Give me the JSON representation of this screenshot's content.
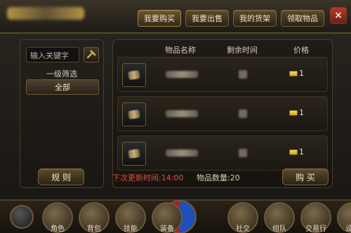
{
  "tabs": [
    "我要购买",
    "我要出售",
    "我的货架",
    "领取物品"
  ],
  "close_label": "×",
  "left_panel": {
    "search_placeholder": "输入关键字",
    "filter_title": "一级筛选",
    "filter_all": "全部"
  },
  "table": {
    "headers": [
      "物品名称",
      "剩余时间",
      "价格"
    ],
    "rows": [
      {
        "price": "1"
      },
      {
        "price": "1"
      },
      {
        "price": "1"
      }
    ]
  },
  "footer": {
    "next_refresh": "下次更新时间:14:00",
    "item_count": "物品数量:20"
  },
  "buttons": {
    "rules": "规 则",
    "buy": "购 买"
  },
  "bottom_menu": [
    "角色",
    "背包",
    "技能",
    "装备",
    "社交",
    "组队",
    "交易行",
    "设置"
  ]
}
